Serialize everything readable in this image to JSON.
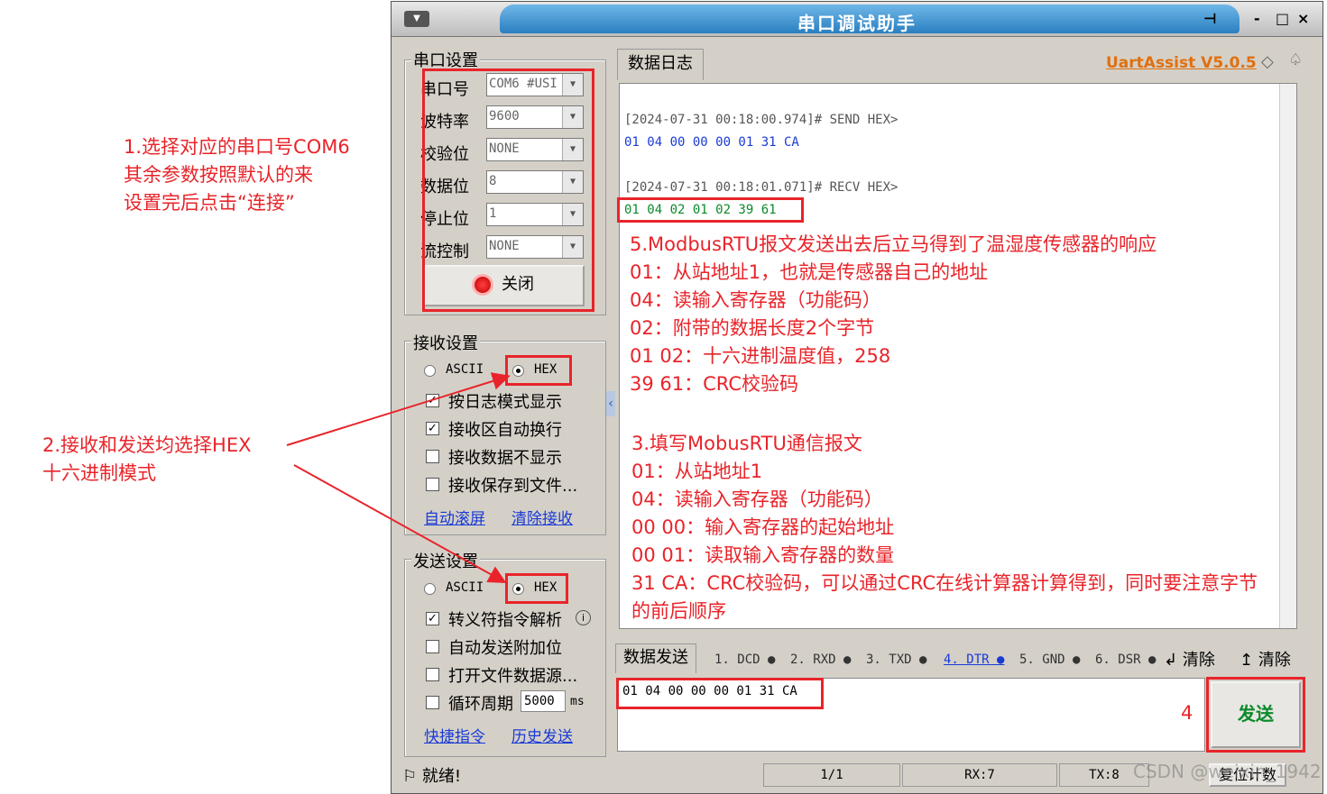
{
  "window": {
    "title": "串口调试助手",
    "version": "UartAssist V5.0.5",
    "min": "-",
    "max": "□",
    "close": "×"
  },
  "serial_settings": {
    "title": "串口设置",
    "port_label": "串口号",
    "port_value": "COM6 #USI",
    "baud_label": "波特率",
    "baud_value": "9600",
    "parity_label": "校验位",
    "parity_value": "NONE",
    "databits_label": "数据位",
    "databits_value": "8",
    "stopbits_label": "停止位",
    "stopbits_value": "1",
    "flow_label": "流控制",
    "flow_value": "NONE",
    "close_button": "关闭"
  },
  "recv_settings": {
    "title": "接收设置",
    "ascii": "ASCII",
    "hex": "HEX",
    "opt1": "按日志模式显示",
    "opt2": "接收区自动换行",
    "opt3": "接收数据不显示",
    "opt4": "接收保存到文件...",
    "link1": "自动滚屏",
    "link2": "清除接收"
  },
  "send_settings": {
    "title": "发送设置",
    "ascii": "ASCII",
    "hex": "HEX",
    "opt1": "转义符指令解析",
    "opt2": "自动发送附加位",
    "opt3": "打开文件数据源...",
    "opt4": "循环周期",
    "period": "5000",
    "unit": "ms",
    "link1": "快捷指令",
    "link2": "历史发送"
  },
  "log": {
    "tab": "数据日志",
    "lines": [
      {
        "text": "[2024-07-31 00:18:00.974]# SEND HEX>",
        "color": "#555555"
      },
      {
        "text": "01 04 00 00 00 01 31 CA",
        "color": "#1a3ad6"
      },
      {
        "text": "[2024-07-31 00:18:01.071]# RECV HEX>",
        "color": "#555555"
      },
      {
        "text": "01 04 02 01 02 39 61",
        "color": "#0a8a2a"
      }
    ]
  },
  "send": {
    "tab": "数据发送",
    "pins": [
      "1. DCD",
      "2. RXD",
      "3. TXD",
      "4. DTR",
      "5. GND",
      "6. DSR"
    ],
    "clear1": "清除",
    "clear2": "清除",
    "input": "01 04 00 00 00 01 31 CA",
    "button": "发送"
  },
  "status": {
    "ready": "就绪!",
    "page": "1/1",
    "rx": "RX:7",
    "tx": "TX:8",
    "reset": "复位计数"
  },
  "annotations": {
    "a1": [
      "1.选择对应的串口号COM6",
      "其余参数按照默认的来",
      "设置完后点击“连接”"
    ],
    "a2": [
      "2.接收和发送均选择HEX",
      "十六进制模式"
    ],
    "a5": [
      "5.ModbusRTU报文发送出去后立马得到了温湿度传感器的响应",
      "01：从站地址1，也就是传感器自己的地址",
      "04：读输入寄存器（功能码）",
      "02：附带的数据长度2个字节",
      "01 02：十六进制温度值，258",
      "39 61：CRC校验码"
    ],
    "a3": [
      "3.填写MobusRTU通信报文",
      "01：从站地址1",
      "04：读输入寄存器（功能码）",
      "00 00：输入寄存器的起始地址",
      "00 01：读取输入寄存器的数量",
      "31 CA：CRC校验码，可以通过CRC在线计算器计算得到，同时要注意字节",
      "的前后顺序"
    ],
    "a4": "4",
    "watermark": "CSDN @weixin_1942"
  }
}
